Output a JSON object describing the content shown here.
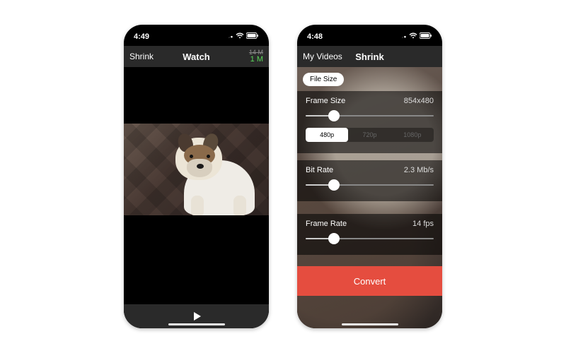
{
  "phone1": {
    "status": {
      "time": "4:49"
    },
    "nav": {
      "left": "Shrink",
      "title": "Watch",
      "right_strike": "14 M",
      "right_green": "1 M"
    },
    "playbar": {
      "icon": "play-icon"
    }
  },
  "phone2": {
    "status": {
      "time": "4:48"
    },
    "nav": {
      "left": "My Videos",
      "title": "Shrink"
    },
    "pill": "File Size",
    "frame_size": {
      "label": "Frame Size",
      "value": "854x480",
      "slider_pct": 22
    },
    "resolutions": {
      "options": [
        "480p",
        "720p",
        "1080p"
      ],
      "selected_index": 0
    },
    "bit_rate": {
      "label": "Bit Rate",
      "value": "2.3 Mb/s",
      "slider_pct": 22
    },
    "frame_rate": {
      "label": "Frame Rate",
      "value": "14 fps",
      "slider_pct": 22
    },
    "convert_label": "Convert"
  },
  "colors": {
    "accent": "#f24a3a",
    "success": "#5bd75b"
  }
}
